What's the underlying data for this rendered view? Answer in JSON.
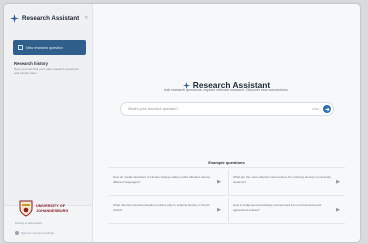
{
  "sidebar": {
    "app_title": "Research Assistant",
    "collapse_glyph": "«",
    "new_question_label": "New research question",
    "history_title": "Research history",
    "history_note": "Here you can find your past research questions and saved notes.",
    "university_name": "UNIVERSITY OF JOHANNESBURG",
    "university_sub": "Faculty of Humanities",
    "signout_label": "Sign out / account settings"
  },
  "main": {
    "title": "Research Assistant",
    "subtitle": "Ask research questions, explore relevant research. Discover new connections.",
    "search_placeholder": "What's your research question?",
    "search_count": "0/500",
    "examples_title": "Example questions",
    "examples": [
      "How do media narratives of climate change shape public attitudes across different languages?",
      "What are the most effective interventions for reducing anxiety in university students?",
      "What role did colonial education policies play in shaping literacy in South Africa?",
      "How is indigenous knowledge incorporated into environmental and agricultural studies?"
    ]
  },
  "colors": {
    "accent": "#2f5f8a",
    "send": "#2f6fa8",
    "university": "#8b1d2b"
  }
}
